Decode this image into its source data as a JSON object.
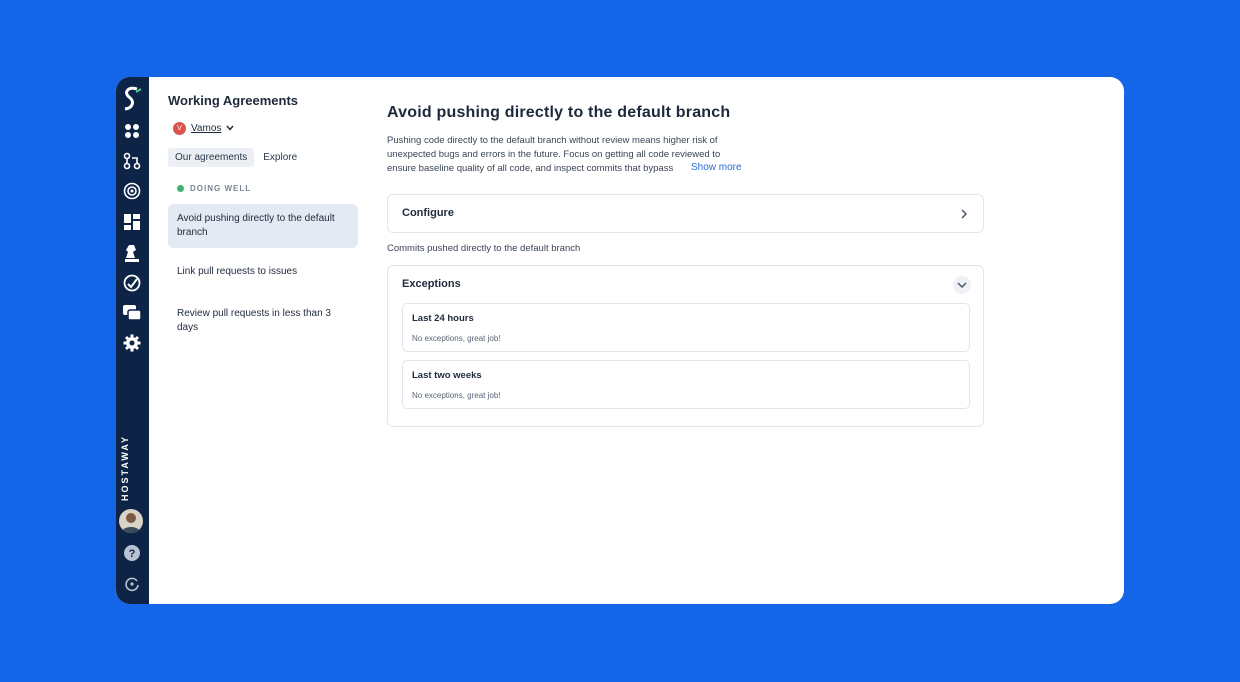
{
  "rail": {
    "brand_text": "HOSTAWAY"
  },
  "panel": {
    "title": "Working Agreements",
    "team_initial": "V",
    "team_name": "Vamos",
    "tabs": [
      {
        "label": "Our agreements"
      },
      {
        "label": "Explore"
      }
    ],
    "section_label": "DOING WELL",
    "agreements": [
      {
        "label": "Avoid pushing directly to the default branch"
      },
      {
        "label": "Link pull requests to issues"
      },
      {
        "label": "Review pull requests in less than 3 days"
      }
    ]
  },
  "main": {
    "title": "Avoid pushing directly to the default branch",
    "description": "Pushing code directly to the default branch without review means higher risk of unexpected bugs and errors in the future. Focus on getting all code reviewed to ensure baseline quality of all code, and inspect commits that bypass",
    "show_more": "Show more",
    "configure_label": "Configure",
    "caption": "Commits pushed directly to the default branch",
    "exceptions_label": "Exceptions",
    "exception_periods": [
      {
        "title": "Last 24 hours",
        "text": "No exceptions, great job!"
      },
      {
        "title": "Last two weeks",
        "text": "No exceptions, great job!"
      }
    ]
  },
  "colors": {
    "background": "#1565e8",
    "rail": "#0e2446",
    "accent": "#2a6bd6",
    "status_good": "#3cb371"
  }
}
